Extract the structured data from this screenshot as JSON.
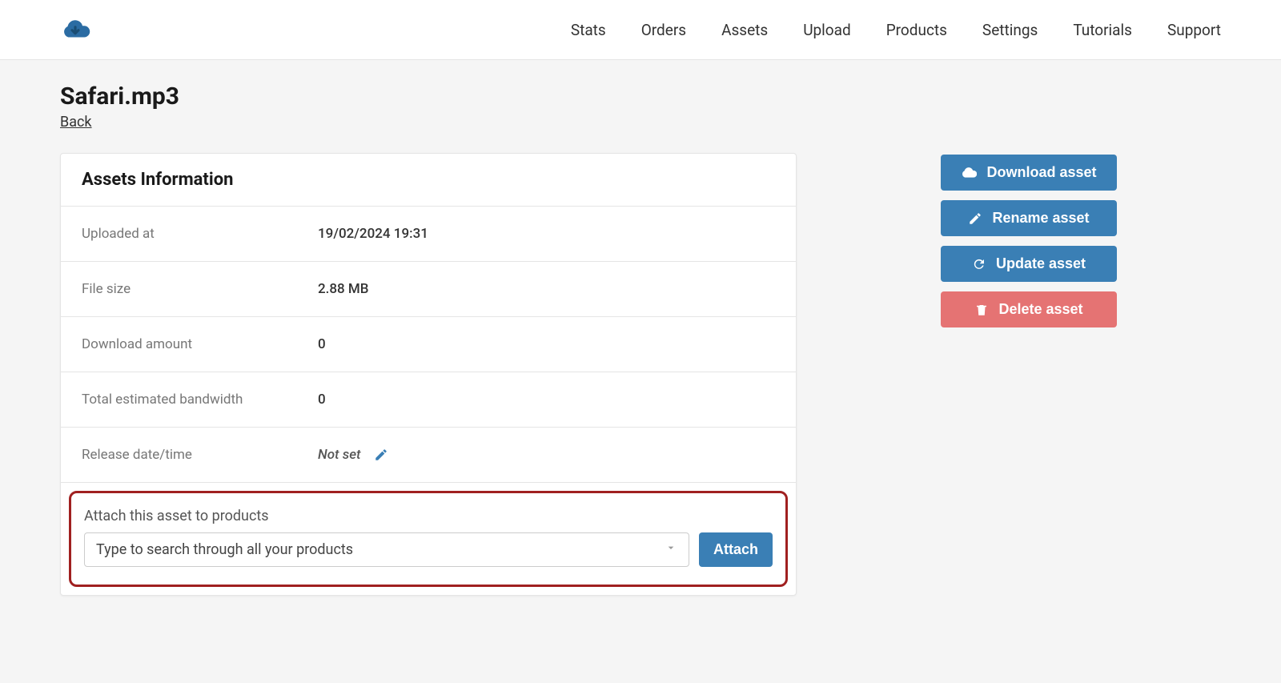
{
  "nav": {
    "items": [
      "Stats",
      "Orders",
      "Assets",
      "Upload",
      "Products",
      "Settings",
      "Tutorials",
      "Support"
    ]
  },
  "page": {
    "title": "Safari.mp3",
    "back_label": "Back"
  },
  "asset_info": {
    "heading": "Assets Information",
    "rows": [
      {
        "label": "Uploaded at",
        "value": "19/02/2024 19:31"
      },
      {
        "label": "File size",
        "value": "2.88 MB"
      },
      {
        "label": "Download amount",
        "value": "0"
      },
      {
        "label": "Total estimated bandwidth",
        "value": "0"
      },
      {
        "label": "Release date/time",
        "value": "Not set",
        "editable": true
      }
    ]
  },
  "attach": {
    "label": "Attach this asset to products",
    "placeholder": "Type to search through all your products",
    "button": "Attach"
  },
  "actions": {
    "download": "Download asset",
    "rename": "Rename asset",
    "update": "Update asset",
    "delete": "Delete asset"
  }
}
